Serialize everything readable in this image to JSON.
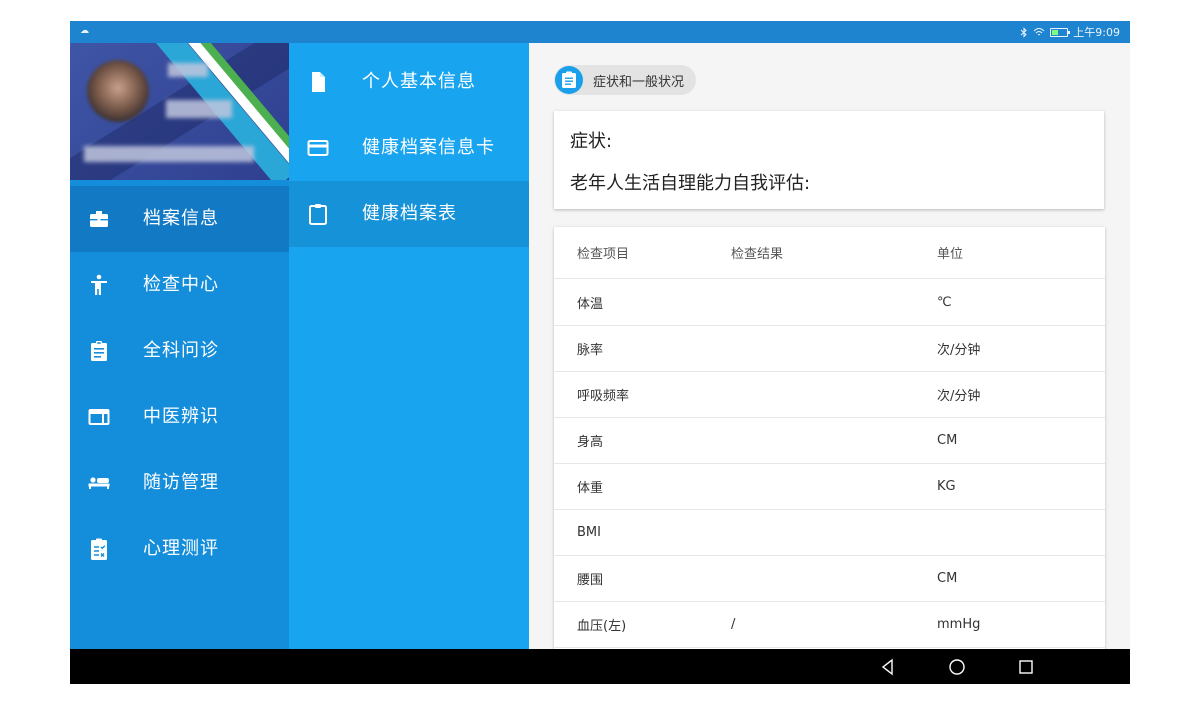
{
  "status_bar": {
    "time": "上午9:09",
    "icons": [
      "bluetooth-icon",
      "wifi-icon",
      "battery-icon"
    ]
  },
  "nav": {
    "items": [
      {
        "label": "档案信息",
        "icon": "briefcase-icon",
        "active": true
      },
      {
        "label": "检查中心",
        "icon": "person-icon",
        "active": false
      },
      {
        "label": "全科问诊",
        "icon": "clipboard-icon",
        "active": false
      },
      {
        "label": "中医辨识",
        "icon": "panel-icon",
        "active": false
      },
      {
        "label": "随访管理",
        "icon": "bed-icon",
        "active": false
      },
      {
        "label": "心理测评",
        "icon": "checklist-icon",
        "active": false
      }
    ]
  },
  "subnav": {
    "items": [
      {
        "label": "个人基本信息",
        "icon": "file-icon",
        "active": false
      },
      {
        "label": "健康档案信息卡",
        "icon": "card-icon",
        "active": false
      },
      {
        "label": "健康档案表",
        "icon": "clipboard-outline-icon",
        "active": true
      }
    ]
  },
  "content": {
    "chip_label": "症状和一般状况",
    "symptom_label": "症状:",
    "self_care_label": "老年人生活自理能力自我评估:",
    "table": {
      "headers": [
        "检查项目",
        "检查结果",
        "单位"
      ],
      "rows": [
        {
          "item": "体温",
          "result": "",
          "unit": "℃"
        },
        {
          "item": "脉率",
          "result": "",
          "unit": "次/分钟"
        },
        {
          "item": "呼吸频率",
          "result": "",
          "unit": "次/分钟"
        },
        {
          "item": "身高",
          "result": "",
          "unit": "CM"
        },
        {
          "item": "体重",
          "result": "",
          "unit": "KG"
        },
        {
          "item": "BMI",
          "result": "",
          "unit": ""
        },
        {
          "item": "腰围",
          "result": "",
          "unit": "CM"
        },
        {
          "item": "血压(左)",
          "result": "/",
          "unit": "mmHg"
        }
      ]
    }
  },
  "colors": {
    "status_bar": "#1f84cf",
    "nav": "#148ddb",
    "nav_active": "#1279c4",
    "subnav": "#19a4ef",
    "subnav_active": "#1692d8",
    "accent": "#1aa0ea"
  }
}
